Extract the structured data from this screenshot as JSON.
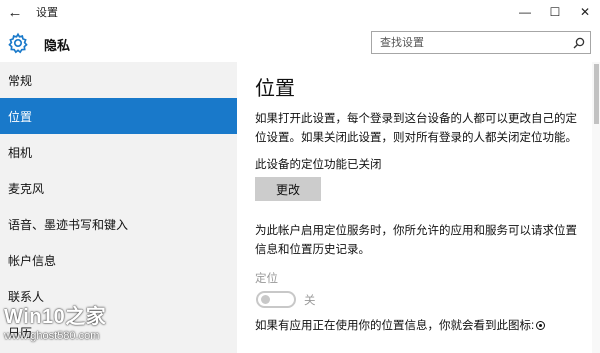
{
  "window": {
    "back_glyph": "←",
    "title": "设置",
    "minimize_glyph": "—",
    "maximize_glyph": "☐",
    "close_glyph": "✕"
  },
  "header": {
    "icon": "gear-icon",
    "section_title": "隐私",
    "search_placeholder": "查找设置",
    "search_icon": "search-icon"
  },
  "sidebar": {
    "items": [
      {
        "label": "常规"
      },
      {
        "label": "位置",
        "active": true
      },
      {
        "label": "相机"
      },
      {
        "label": "麦克风"
      },
      {
        "label": "语音、墨迹书写和键入"
      },
      {
        "label": "帐户信息"
      },
      {
        "label": "联系人"
      },
      {
        "label": "日历"
      }
    ]
  },
  "content": {
    "title": "位置",
    "intro": "如果打开此设置，每个登录到这台设备的人都可以更改自己的定位设置。如果关闭此设置，则对所有登录的人都关闭定位功能。",
    "device_status": "此设备的定位功能已关闭",
    "change_button": "更改",
    "account_desc": "为此帐户启用定位服务时，你所允许的应用和服务可以请求位置信息和位置历史记录。",
    "toggle_label": "定位",
    "toggle_state": "关",
    "toggle_on": false,
    "footer_text": "如果有应用正在使用你的位置信息，你就会看到此图标:"
  },
  "watermark": {
    "brand": "Win10之家",
    "url": "www.ghost580.com"
  },
  "colors": {
    "accent": "#1979ca",
    "sidebar_bg": "#f2f2f2",
    "button_bg": "#cccccc",
    "disabled_text": "#999999"
  }
}
